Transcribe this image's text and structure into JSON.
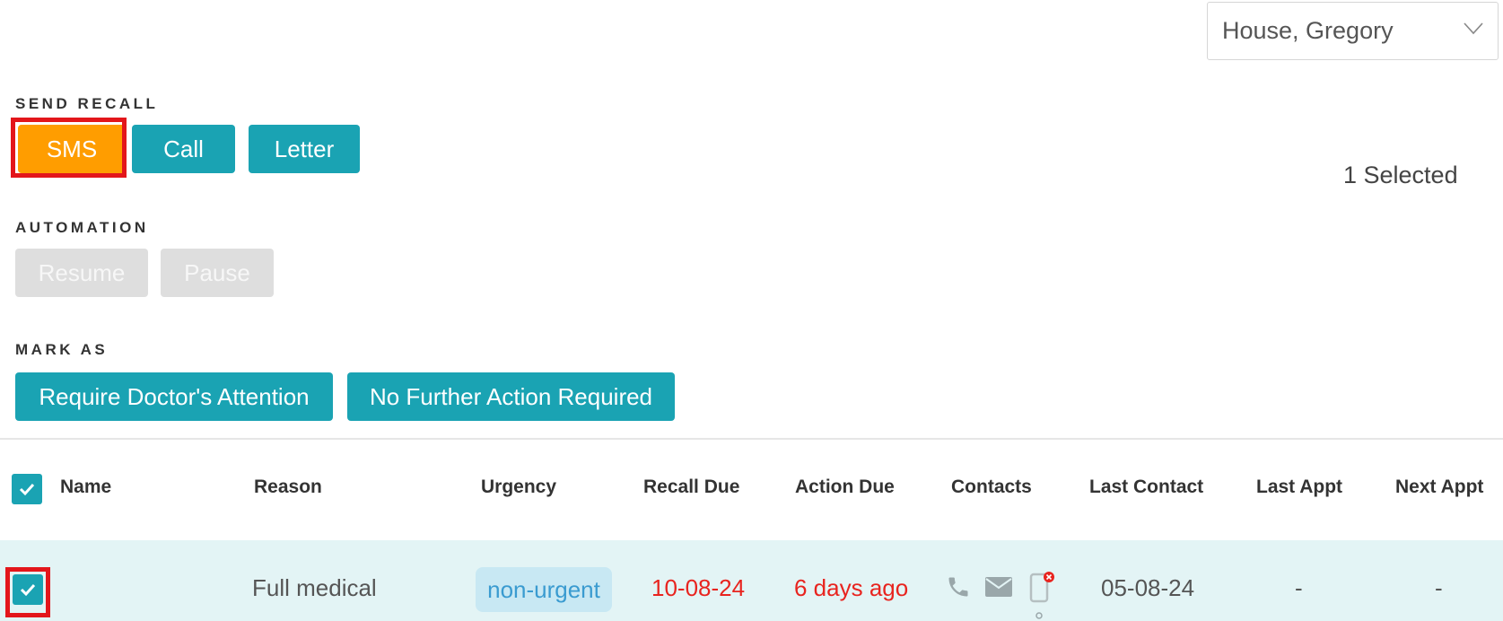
{
  "provider_select": {
    "value": "House, Gregory",
    "icon": "chevron-down-icon"
  },
  "send_recall": {
    "label": "SEND RECALL",
    "sms": "SMS",
    "call": "Call",
    "letter": "Letter"
  },
  "selection": {
    "count_text": "1 Selected"
  },
  "automation": {
    "label": "AUTOMATION",
    "resume": "Resume",
    "pause": "Pause"
  },
  "mark_as": {
    "label": "MARK AS",
    "require_doctor": "Require Doctor's Attention",
    "no_further_action": "No Further Action Required"
  },
  "table": {
    "columns": [
      "Name",
      "Reason",
      "Urgency",
      "Recall Due",
      "Action Due",
      "Contacts",
      "Last Contact",
      "Last Appt",
      "Next Appt"
    ],
    "rows": [
      {
        "checked": true,
        "name": "",
        "reason": "Full medical",
        "urgency": "non-urgent",
        "recall_due": "10-08-24",
        "action_due": "6 days ago",
        "contacts": [
          "phone-icon",
          "mail-icon",
          "mobile-icon"
        ],
        "last_contact": "05-08-24",
        "last_appt": "-",
        "next_appt": "-"
      }
    ]
  },
  "colors": {
    "teal": "#1aa3b3",
    "orange": "#ff9d00",
    "highlight_red": "#e3161b",
    "overdue_red": "#e8241f",
    "row_selected": "#e3f4f5"
  }
}
